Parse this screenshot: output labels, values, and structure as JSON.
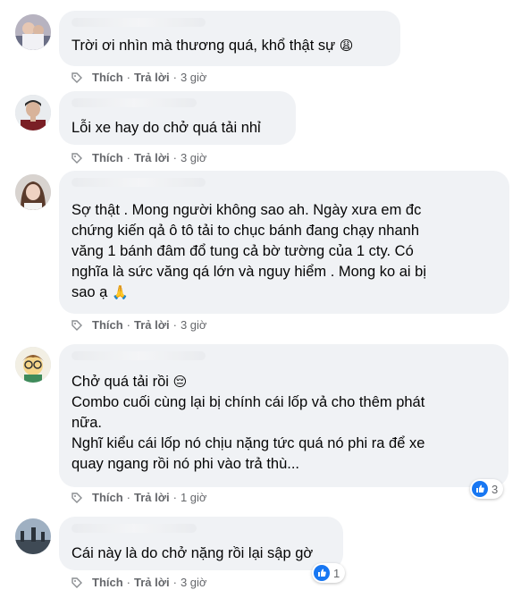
{
  "actions": {
    "like_label": "Thích",
    "reply_label": "Trả lời",
    "separator": "·"
  },
  "comments": [
    {
      "text": "Trời ơi nhìn mà thương quá, khổ thật sự",
      "emoji": "😩",
      "time": "3 giờ"
    },
    {
      "text": "Lỗi xe hay do chở quá tải nhỉ",
      "time": "3 giờ"
    },
    {
      "text": "Sợ thật . Mong người không sao ah. Ngày xưa em đc\nchứng kiến qả ô tô tải to chục bánh đang chạy nhanh\nvăng 1 bánh đâm đổ tung cả bờ tường của 1 cty. Có\nnghĩa là sức văng qá lớn và nguy hiểm . Mong ko ai bị\nsao ạ",
      "emoji": "🙏",
      "time": "3 giờ"
    },
    {
      "text_line1": "Chở quá tải rồi",
      "emoji": "😔",
      "text_rest": "Combo cuối cùng lại bị chính cái lốp vả cho thêm phát\nnữa.\nNghĩ kiểu cái lốp nó chịu nặng tức quá nó phi ra để xe\nquay ngang rồi nó phi vào trả thù...",
      "time": "1 giờ",
      "reaction_count": "3"
    },
    {
      "text": "Cái này là do chở nặng rồi lại sập gờ",
      "time": "3 giờ",
      "reaction_count": "1"
    }
  ]
}
